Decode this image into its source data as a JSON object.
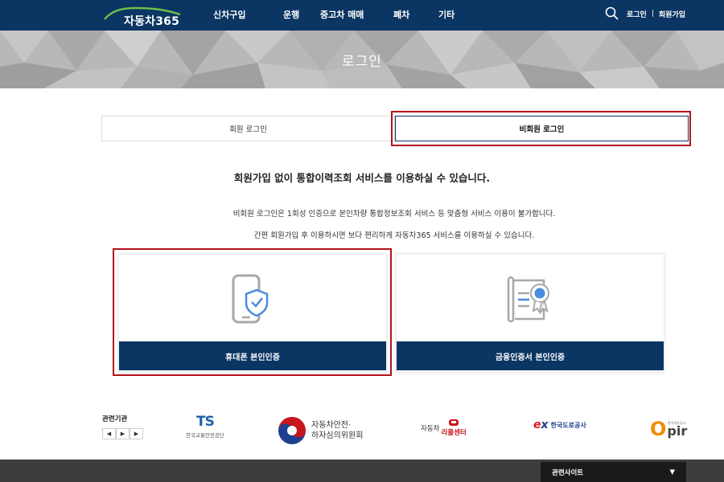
{
  "header": {
    "logo_text": "자동차365",
    "nav": [
      "신차구입",
      "운행",
      "중고차 매매",
      "폐차",
      "기타"
    ],
    "login": "로그인",
    "separator": "|",
    "signup": "회원가입"
  },
  "banner": {
    "title": "로그인"
  },
  "tabs": [
    {
      "label": "회원 로그인",
      "active": false
    },
    {
      "label": "비회원 로그인",
      "active": true
    }
  ],
  "content": {
    "headline": "회원가입 없이 통합이력조회 서비스를 이용하실 수 있습니다.",
    "desc1": "비회원 로그인은 1회성 인증으로 본인차량 통합정보조회 서비스 등 맞춤형 서비스 이용이 불가합니다.",
    "desc2": "간편 회원가입 후 이용하시면 보다 편리하게 자동차365 서비스를 이용하실 수 있습니다."
  },
  "cards": {
    "phone": {
      "icon": "phone-shield-icon",
      "button": "휴대폰 본인인증"
    },
    "cert": {
      "icon": "certificate-icon",
      "button": "금융인증서 본인인증"
    }
  },
  "related": {
    "label": "관련기관",
    "controls": [
      "◀",
      "▶",
      "▶"
    ],
    "orgs": {
      "ts_mark_t": "T",
      "ts_mark_s": "S",
      "ts_name": "한국교통안전공단",
      "krc_line1": "자동차안전·",
      "krc_line2": "하자심의위원회",
      "recall_prefix": "자동차",
      "recall_main": "리콜센터",
      "ex_mark_e": "e",
      "ex_mark_x": "x",
      "ex_name": "한국도로공사",
      "opir_o": "O",
      "opir_rest": "pir",
      "opir_small": "한국석유공사"
    }
  },
  "footer": {
    "site_select": "관련사이트",
    "arrow": "▼"
  },
  "colors": {
    "navy": "#0b3563",
    "highlight": "#b3121b",
    "footer": "#3d3d3d"
  }
}
